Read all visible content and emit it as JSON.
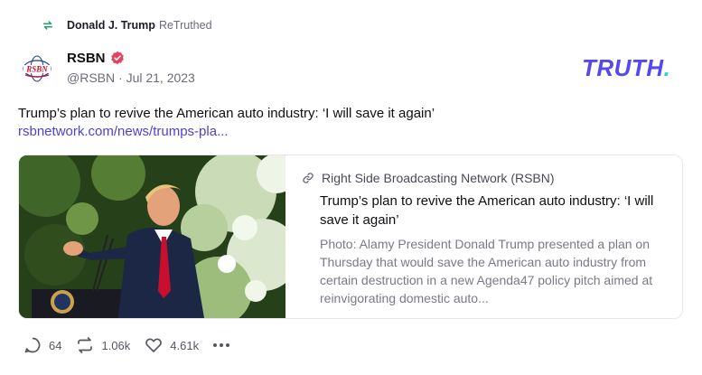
{
  "retruth": {
    "name": "Donald J. Trump",
    "label": "ReTruthed"
  },
  "author": {
    "name": "RSBN",
    "handle": "@RSBN",
    "separator": "·",
    "date": "Jul 21, 2023",
    "avatar_text": "RSBN"
  },
  "brand": {
    "logo_text": "TRUTH",
    "logo_dot": ".",
    "primary_color": "#5448ee",
    "accent_color": "#17e2c7"
  },
  "post": {
    "text": "Trump’s plan to revive the American auto industry: ‘I will save it again’",
    "link": "rsbnetwork.com/news/trumps-pla..."
  },
  "card": {
    "site": "Right Side Broadcasting Network (RSBN)",
    "title": "Trump’s plan to revive the American auto industry: ‘I will save it again’",
    "description": "Photo: Alamy President Donald Trump presented a plan on Thursday that would save the American auto industry from certain destruction in a new Agenda47 policy pitch aimed at reinvigorating domestic auto..."
  },
  "actions": {
    "replies": "64",
    "retruths": "1.06k",
    "likes": "4.61k"
  },
  "icons": {
    "retruth": "retruth-icon",
    "verified": "verified-badge-icon",
    "link": "link-icon",
    "reply": "reply-icon",
    "retruth_action": "retruth-icon",
    "like": "heart-icon",
    "more": "more-icon"
  }
}
